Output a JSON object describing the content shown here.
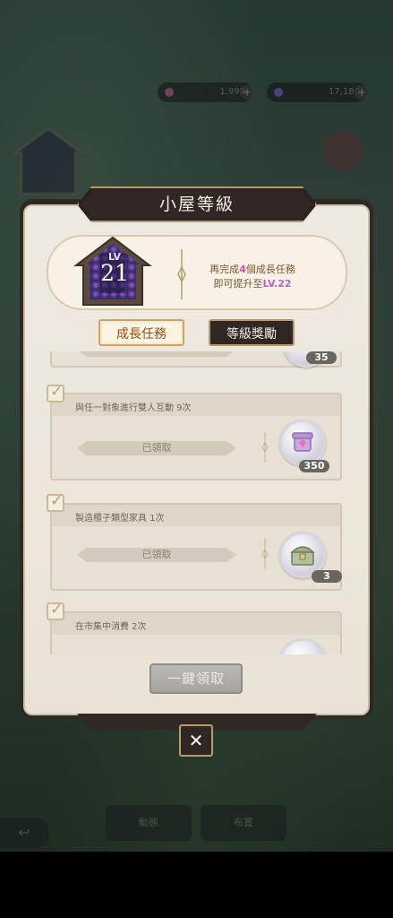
{
  "hud": {
    "currency_left": "1,999",
    "currency_right": "17,180"
  },
  "dialog": {
    "title": "小屋等級",
    "level_prefix": "LV",
    "level": "21",
    "info_line1_a": "再完成",
    "info_line1_num": "4",
    "info_line1_b": "個成長任務",
    "info_line2_a": "即可提升至",
    "info_line2_lv": "LV.22"
  },
  "tabs": [
    {
      "label": "成長任務",
      "active": true
    },
    {
      "label": "等級獎勵",
      "active": false
    }
  ],
  "tasks": [
    {
      "title": "",
      "status": "",
      "reward_count": "35"
    },
    {
      "title": "與任一對象進行雙人互動 9次",
      "status": "已領取",
      "reward_count": "350",
      "reward_icon": "gem-box-icon"
    },
    {
      "title": "製造櫃子類型家具 1次",
      "status": "已領取",
      "reward_count": "3",
      "reward_icon": "treasure-chest-icon"
    },
    {
      "title": "在市集中消費 2次",
      "status": "",
      "reward_count": ""
    }
  ],
  "claim_all_label": "一鍵領取",
  "close_label": "✕",
  "background_nav": {
    "left": "動態",
    "right": "布置"
  },
  "colors": {
    "accent_pink": "#d94fa4",
    "accent_purple": "#b65fd1",
    "frame_dark": "#2f2824",
    "gold_border": "#b49873"
  }
}
